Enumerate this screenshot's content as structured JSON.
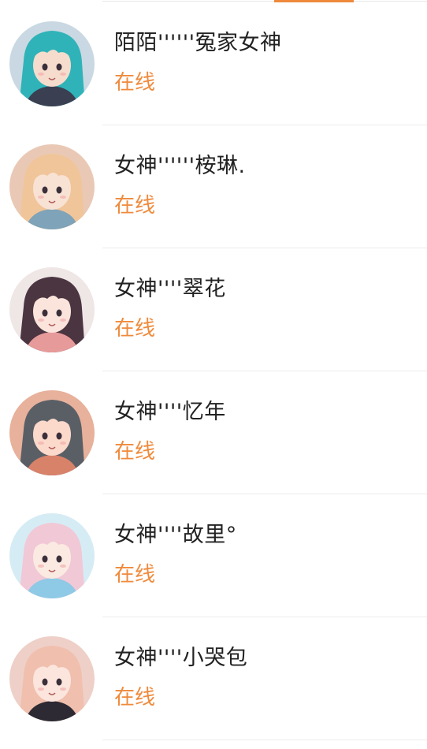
{
  "theme": {
    "accent": "#ef8a3c",
    "name_color": "#222222",
    "divider": "#ececec"
  },
  "contacts": [
    {
      "name": "陌陌''''''冤家女神",
      "status": "在线",
      "avatar": {
        "icon": "anime-avatar-teal-twintails",
        "bg": "#c9d8e2",
        "hair": "#2fb3b8",
        "skin": "#f6dccd",
        "accent": "#3b3f52"
      }
    },
    {
      "name": "女神''''''桉琳.",
      "status": "在线",
      "avatar": {
        "icon": "anime-avatar-blonde",
        "bg": "#e9c9b5",
        "hair": "#f0c59a",
        "skin": "#f8e2d4",
        "accent": "#7fa3b8"
      }
    },
    {
      "name": "女神''''翠花",
      "status": "在线",
      "avatar": {
        "icon": "anime-avatar-brown-smile",
        "bg": "#efe6e6",
        "hair": "#4a3540",
        "skin": "#fbe4dc",
        "accent": "#e79a9a"
      }
    },
    {
      "name": "女神''''忆年",
      "status": "在线",
      "avatar": {
        "icon": "anime-avatar-gray-hair",
        "bg": "#e7b19c",
        "hair": "#5a5f66",
        "skin": "#fbd9cb",
        "accent": "#d9826a"
      }
    },
    {
      "name": "女神''''故里°",
      "status": "在线",
      "avatar": {
        "icon": "anime-avatar-pink-hair",
        "bg": "#d6ecf5",
        "hair": "#f1c8d6",
        "skin": "#fbeae2",
        "accent": "#8ec9e6"
      }
    },
    {
      "name": "女神''''小哭包",
      "status": "在线",
      "avatar": {
        "icon": "anime-avatar-pink-blonde",
        "bg": "#eed0c8",
        "hair": "#f0bfae",
        "skin": "#fbe5dc",
        "accent": "#2d2a33"
      }
    }
  ]
}
